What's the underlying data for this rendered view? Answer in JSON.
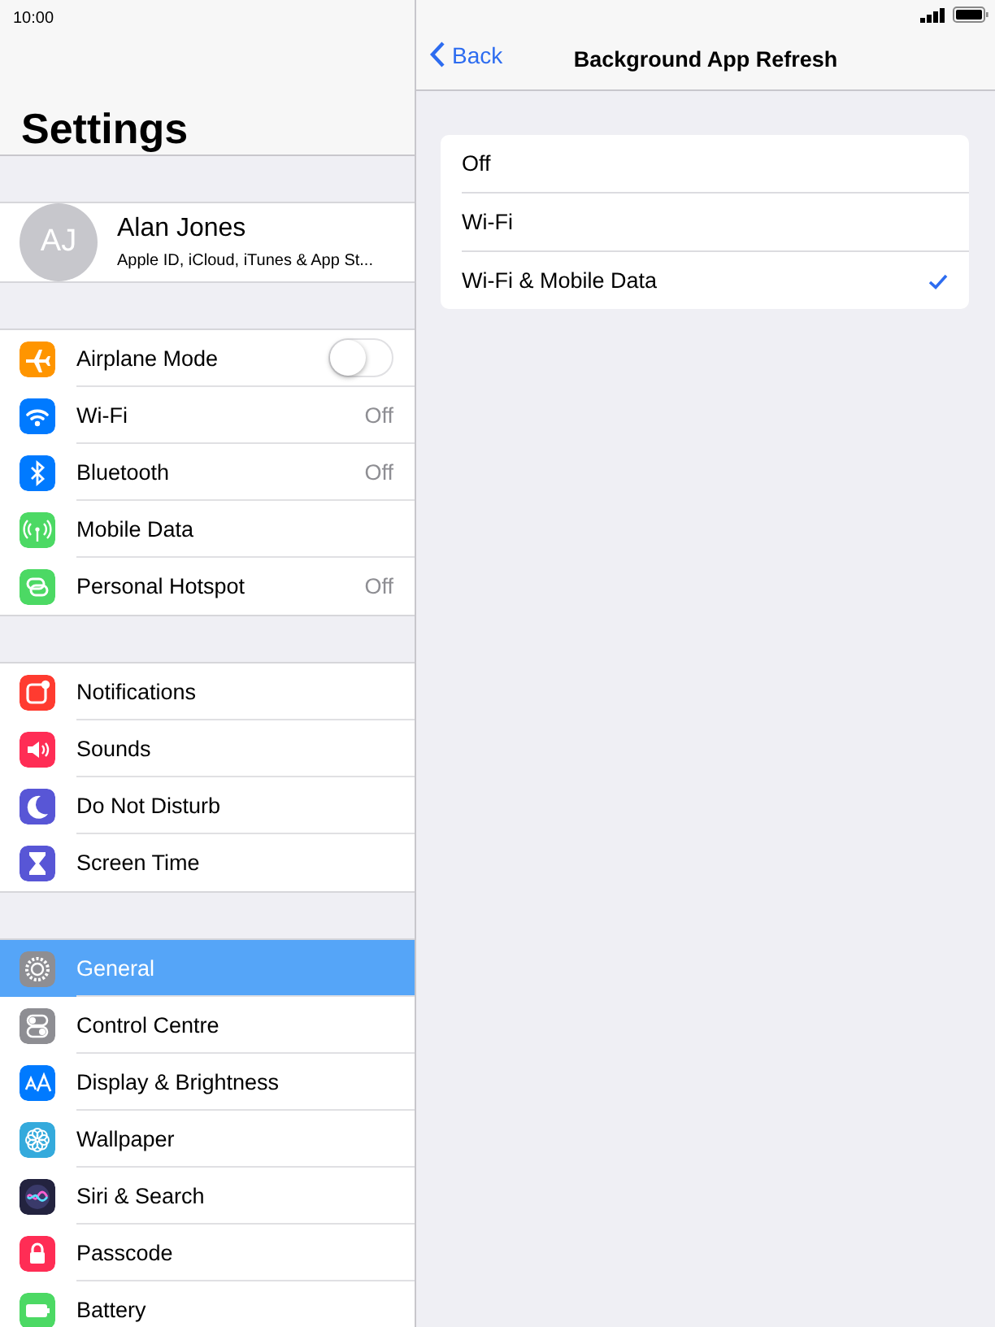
{
  "status_bar": {
    "time": "10:00"
  },
  "sidebar": {
    "title": "Settings",
    "profile": {
      "initials": "AJ",
      "name": "Alan Jones",
      "subtitle": "Apple ID, iCloud, iTunes & App St..."
    },
    "groups": [
      [
        {
          "label": "Airplane Mode",
          "kind": "toggle",
          "on": false,
          "color": "#ff9500",
          "selected": false
        },
        {
          "label": "Wi-Fi",
          "kind": "value",
          "value": "Off",
          "color": "#007aff",
          "selected": false
        },
        {
          "label": "Bluetooth",
          "kind": "value",
          "value": "Off",
          "color": "#007aff",
          "selected": false
        },
        {
          "label": "Mobile Data",
          "kind": "plain",
          "color": "#4cd964",
          "selected": false
        },
        {
          "label": "Personal Hotspot",
          "kind": "value",
          "value": "Off",
          "color": "#4cd964",
          "selected": false
        }
      ],
      [
        {
          "label": "Notifications",
          "kind": "plain",
          "color": "#ff3b30",
          "selected": false
        },
        {
          "label": "Sounds",
          "kind": "plain",
          "color": "#ff2d55",
          "selected": false
        },
        {
          "label": "Do Not Disturb",
          "kind": "plain",
          "color": "#5856d6",
          "selected": false
        },
        {
          "label": "Screen Time",
          "kind": "plain",
          "color": "#5856d6",
          "selected": false
        }
      ],
      [
        {
          "label": "General",
          "kind": "plain",
          "color": "#8e8e93",
          "selected": true
        },
        {
          "label": "Control Centre",
          "kind": "plain",
          "color": "#8e8e93",
          "selected": false
        },
        {
          "label": "Display & Brightness",
          "kind": "plain",
          "color": "#007aff",
          "selected": false
        },
        {
          "label": "Wallpaper",
          "kind": "plain",
          "color": "#34aadc",
          "selected": false
        },
        {
          "label": "Siri & Search",
          "kind": "plain",
          "color": "#23233f",
          "selected": false
        },
        {
          "label": "Passcode",
          "kind": "plain",
          "color": "#ff2d55",
          "selected": false
        },
        {
          "label": "Battery",
          "kind": "plain",
          "color": "#4cd964",
          "selected": false
        }
      ]
    ]
  },
  "detail": {
    "back": "Back",
    "title": "Background App Refresh",
    "options": [
      {
        "label": "Off",
        "selected": false
      },
      {
        "label": "Wi-Fi",
        "selected": false
      },
      {
        "label": "Wi-Fi & Mobile Data",
        "selected": true
      }
    ]
  }
}
